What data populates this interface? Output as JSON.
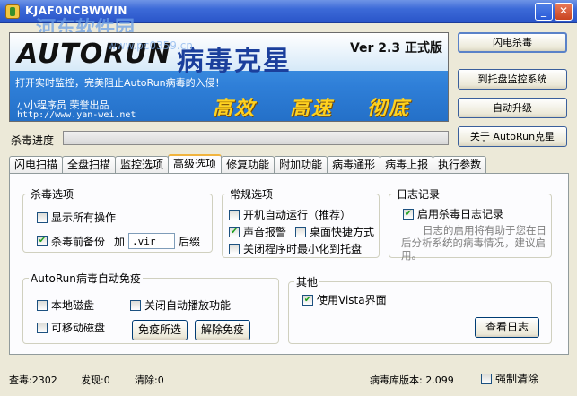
{
  "window": {
    "title": "KJAF0NCBWWIN",
    "watermark": "河东软件园",
    "watermark_url": "www.pc0359.cn",
    "controls": {
      "minimize": "_",
      "close": "✕"
    }
  },
  "banner": {
    "logo": "AUTORUN",
    "logo_cn": "病毒克星",
    "version": "Ver 2.3 正式版",
    "tagline": "打开实时监控，完美阻止AutoRun病毒的入侵！",
    "author": "小小程序员 荣誉出品",
    "site": "http://www.yan-wei.net",
    "slogans": [
      "高效",
      "高速",
      "彻底"
    ]
  },
  "side_buttons": {
    "flash_kill": "闪电杀毒",
    "tray_monitor": "到托盘监控系统",
    "auto_upgrade": "自动升级",
    "about": "关于 AutoRun克星"
  },
  "progress": {
    "label": "杀毒进度",
    "value": 0
  },
  "tabs": [
    "闪电扫描",
    "全盘扫描",
    "监控选项",
    "高级选项",
    "修复功能",
    "附加功能",
    "病毒通形",
    "病毒上报",
    "执行参数"
  ],
  "active_tab": "高级选项",
  "kill_options": {
    "title": "杀毒选项",
    "show_all": {
      "label": "显示所有操作",
      "checked": false
    },
    "backup": {
      "label": "杀毒前备份",
      "checked": true
    },
    "add_label": "加",
    "suffix_value": ".vir",
    "suffix_label": "后缀"
  },
  "general_options": {
    "title": "常规选项",
    "autorun": {
      "label": "开机自动运行（推荐）",
      "checked": false
    },
    "sound": {
      "label": "声音报警",
      "checked": true
    },
    "desktop_shortcut": {
      "label": "桌面快捷方式",
      "checked": false
    },
    "minimize_tray": {
      "label": "关闭程序时最小化到托盘",
      "checked": false
    }
  },
  "log": {
    "title": "日志记录",
    "enable": {
      "label": "启用杀毒日志记录",
      "checked": true
    },
    "hint": "日志的启用将有助于您在日后分析系统的病毒情况，建议启用。"
  },
  "immune": {
    "title": "AutoRun病毒自动免疫",
    "local_disk": {
      "label": "本地磁盘",
      "checked": false
    },
    "disable_autoplay": {
      "label": "关闭自动播放功能",
      "checked": false
    },
    "removable_disk": {
      "label": "可移动磁盘",
      "checked": false
    },
    "immune_btn": "免疫所选",
    "unimmune_btn": "解除免疫"
  },
  "other": {
    "title": "其他",
    "vista_ui": {
      "label": "使用Vista界面",
      "checked": true
    },
    "view_log_btn": "查看日志"
  },
  "status": {
    "scanned": "查毒:2302",
    "found": "发现:0",
    "cleared": "清除:0",
    "db_version": "病毒库版本: 2.099",
    "force_clear": {
      "label": "强制清除",
      "checked": false
    }
  }
}
